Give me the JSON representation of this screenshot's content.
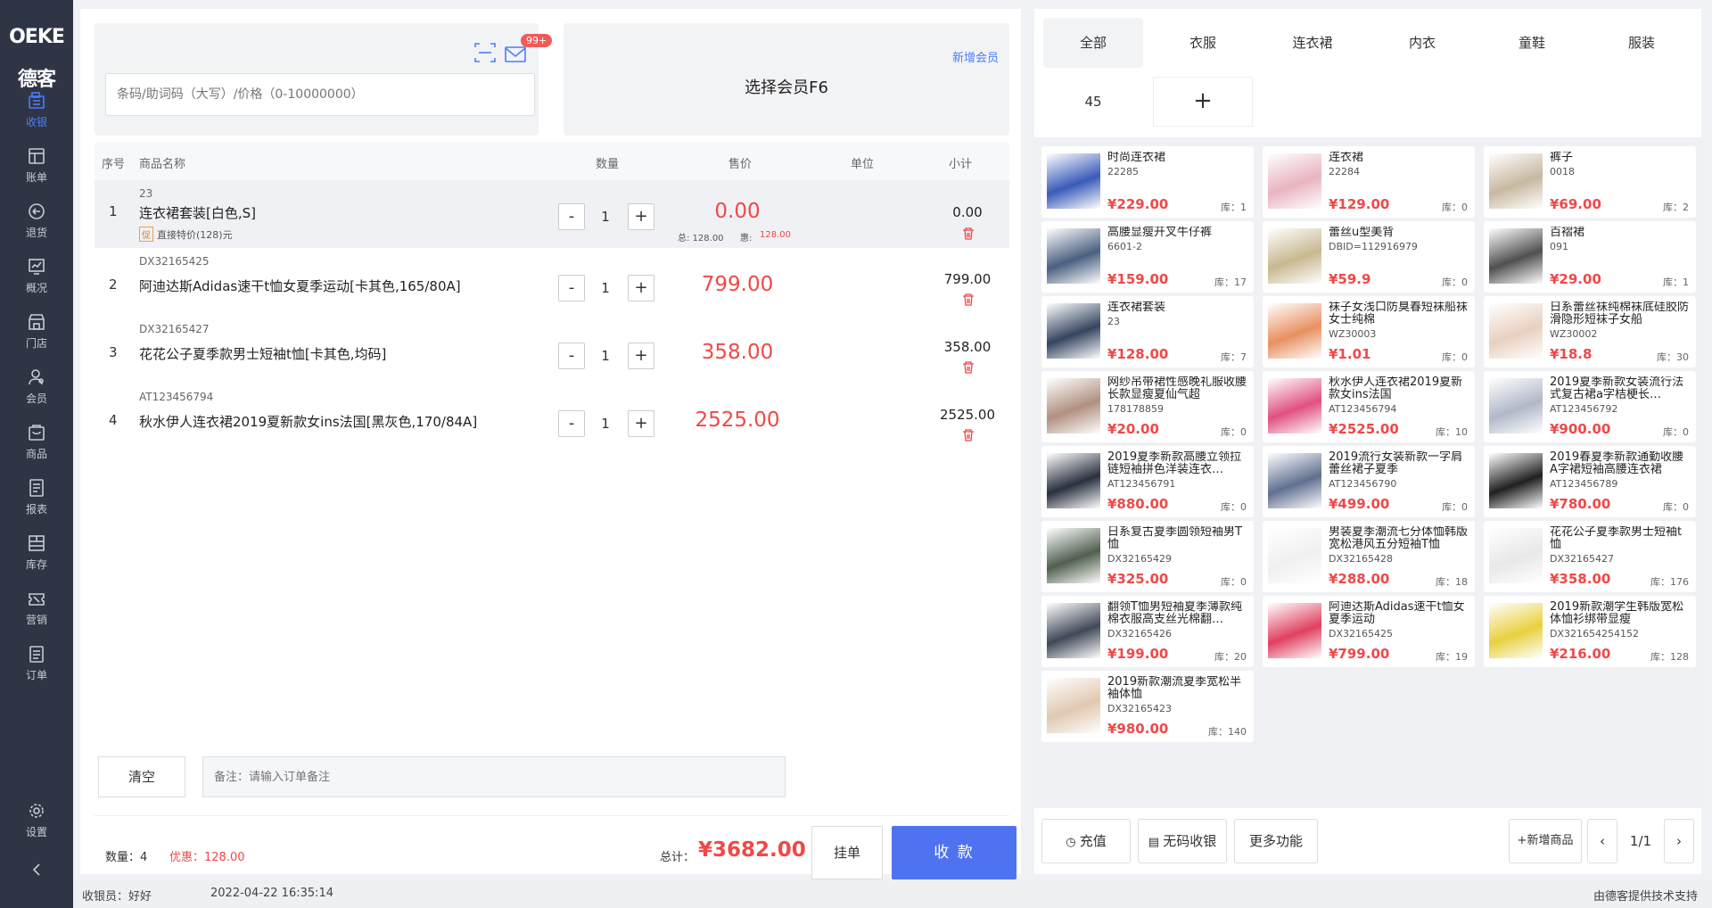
{
  "brand": {
    "logo_text": "OEKE德客"
  },
  "sidebar": {
    "items": [
      {
        "label": "收银",
        "icon": "cashier-icon",
        "active": true
      },
      {
        "label": "账单",
        "icon": "bill-icon"
      },
      {
        "label": "退货",
        "icon": "return-icon"
      },
      {
        "label": "概况",
        "icon": "overview-icon"
      },
      {
        "label": "门店",
        "icon": "store-icon"
      },
      {
        "label": "会员",
        "icon": "member-icon"
      },
      {
        "label": "商品",
        "icon": "goods-icon"
      },
      {
        "label": "报表",
        "icon": "report-icon"
      },
      {
        "label": "库存",
        "icon": "inventory-icon"
      },
      {
        "label": "营销",
        "icon": "marketing-icon"
      },
      {
        "label": "订单",
        "icon": "order-icon"
      }
    ],
    "settings_label": "设置"
  },
  "search": {
    "placeholder": "条码/助词码（大写）/价格（0-10000000）",
    "badge": "99+"
  },
  "member": {
    "title": "选择会员F6",
    "add_label": "新增会员"
  },
  "table": {
    "headers": {
      "no": "序号",
      "name": "商品名称",
      "qty": "数量",
      "price": "售价",
      "unit": "单位",
      "subtotal": "小计"
    },
    "rows": [
      {
        "no": "1",
        "code": "23",
        "name": "连衣裙套装[白色,S]",
        "qty": "1",
        "price": "0.00",
        "subtotal": "0.00",
        "total_label": "总: 128.00",
        "discount_label": "惠:",
        "discount": "128.00",
        "promo_tag": "促",
        "promo_text": "直接特价(128)元"
      },
      {
        "no": "2",
        "code": "DX32165425",
        "name": "阿迪达斯Adidas速干t恤女夏季运动[卡其色,165/80A]",
        "qty": "1",
        "price": "799.00",
        "subtotal": "799.00"
      },
      {
        "no": "3",
        "code": "DX32165427",
        "name": "花花公子夏季款男士短袖t恤[卡其色,均码]",
        "qty": "1",
        "price": "358.00",
        "subtotal": "358.00"
      },
      {
        "no": "4",
        "code": "AT123456794",
        "name": "秋水伊人连衣裙2019夏新款女ins法国[黑灰色,170/84A]",
        "qty": "1",
        "price": "2525.00",
        "subtotal": "2525.00"
      }
    ]
  },
  "actions": {
    "clear": "清空",
    "remark_placeholder": "备注：请输入订单备注",
    "hang": "挂单",
    "pay": "收 款"
  },
  "summary": {
    "qty_label": "数量：",
    "qty": "4",
    "discount_label": "优惠：",
    "discount": "128.00",
    "total_label": "总计：",
    "total": "¥3682.00"
  },
  "categories": {
    "tabs": [
      "全部",
      "衣服",
      "连衣裙",
      "内衣",
      "童鞋",
      "服装"
    ],
    "extra": "45",
    "add": "+"
  },
  "products": [
    {
      "name": "时尚连衣裙",
      "code": "22285",
      "price": "¥229.00",
      "stock": "库：1",
      "color": "#3a5bb8"
    },
    {
      "name": "连衣裙",
      "code": "22284",
      "price": "¥129.00",
      "stock": "库：0",
      "color": "#e8b4c0"
    },
    {
      "name": "裤子",
      "code": "0018",
      "price": "¥69.00",
      "stock": "库：2",
      "color": "#c8b8a0"
    },
    {
      "name": "高腰显瘦开叉牛仔裤",
      "code": "6601-2",
      "price": "¥159.00",
      "stock": "库：17",
      "color": "#4a6080"
    },
    {
      "name": "蕾丝u型美背",
      "code": "DBID=112916979",
      "price": "¥59.9",
      "stock": "库：0",
      "color": "#c8b890"
    },
    {
      "name": "百褶裙",
      "code": "091",
      "price": "¥29.00",
      "stock": "库：1",
      "color": "#505050"
    },
    {
      "name": "连衣裙套装",
      "code": "23",
      "price": "¥128.00",
      "stock": "库：7",
      "color": "#354560"
    },
    {
      "name": "袜子女浅口防臭春短袜船袜女士纯棉",
      "code": "WZ30003",
      "price": "¥1.01",
      "stock": "库：0",
      "color": "#e89060"
    },
    {
      "name": "日系蕾丝袜纯棉袜底硅胶防滑隐形短袜子女船",
      "code": "WZ30002",
      "price": "¥18.8",
      "stock": "库：30",
      "color": "#e8d0c0"
    },
    {
      "name": "网纱吊带裙性感晚礼服收腰长款显瘦夏仙气超",
      "code": "178178859",
      "price": "¥20.00",
      "stock": "库：0",
      "color": "#b09080"
    },
    {
      "name": "秋水伊人连衣裙2019夏新款女ins法国",
      "code": "AT123456794",
      "price": "¥2525.00",
      "stock": "库：10",
      "color": "#e05080"
    },
    {
      "name": "2019夏季新款女装流行法式复古裙a字桔梗长…",
      "code": "AT123456792",
      "price": "¥900.00",
      "stock": "库：0",
      "color": "#b0b8c8"
    },
    {
      "name": "2019夏季新款高腰立领拉链短袖拼色洋装连衣…",
      "code": "AT123456791",
      "price": "¥880.00",
      "stock": "库：0",
      "color": "#2a3040"
    },
    {
      "name": "2019流行女装新款一字肩蕾丝裙子夏季",
      "code": "AT123456790",
      "price": "¥499.00",
      "stock": "库：0",
      "color": "#607090"
    },
    {
      "name": "2019春夏季新款通勤收腰A字裙短袖高腰连衣裙",
      "code": "AT123456789",
      "price": "¥780.00",
      "stock": "库：0",
      "color": "#202020"
    },
    {
      "name": "日系复古夏季圆领短袖男T恤",
      "code": "DX32165429",
      "price": "¥325.00",
      "stock": "库：0",
      "color": "#506050"
    },
    {
      "name": "男装夏季潮流七分体恤韩版宽松港风五分短袖T恤",
      "code": "DX32165428",
      "price": "¥288.00",
      "stock": "库：18",
      "color": "#f0f0f0"
    },
    {
      "name": "花花公子夏季款男士短袖t恤",
      "code": "DX32165427",
      "price": "¥358.00",
      "stock": "库：176",
      "color": "#e8e8e8"
    },
    {
      "name": "翻领T恤男短袖夏季薄款纯棉衣服高支丝光棉翻…",
      "code": "DX32165426",
      "price": "¥199.00",
      "stock": "库：20",
      "color": "#404858"
    },
    {
      "name": "阿迪达斯Adidas速干t恤女夏季运动",
      "code": "DX32165425",
      "price": "¥799.00",
      "stock": "库：19",
      "color": "#e04060"
    },
    {
      "name": "2019新款潮学生韩版宽松体恤衫绑带显瘦",
      "code": "DX321654254152",
      "price": "¥216.00",
      "stock": "库：128",
      "color": "#e8d040"
    },
    {
      "name": "2019新款潮流夏季宽松半袖体恤",
      "code": "DX32165423",
      "price": "¥980.00",
      "stock": "库：140",
      "color": "#e0c8b0"
    }
  ],
  "bottom_buttons": {
    "recharge": "充值",
    "nocode": "无码收银",
    "more": "更多功能",
    "add_goods": "+新增商品",
    "page": "1/1",
    "prev": "‹",
    "next": "›"
  },
  "status": {
    "cashier_label": "收银员：",
    "cashier": "好好",
    "datetime": "2022-04-22 16:35:14",
    "support": "由德客提供技术支持"
  },
  "colors": {
    "accent": "#4f73f0",
    "price_red": "#f04848",
    "sidebar_bg": "#2f3545"
  }
}
